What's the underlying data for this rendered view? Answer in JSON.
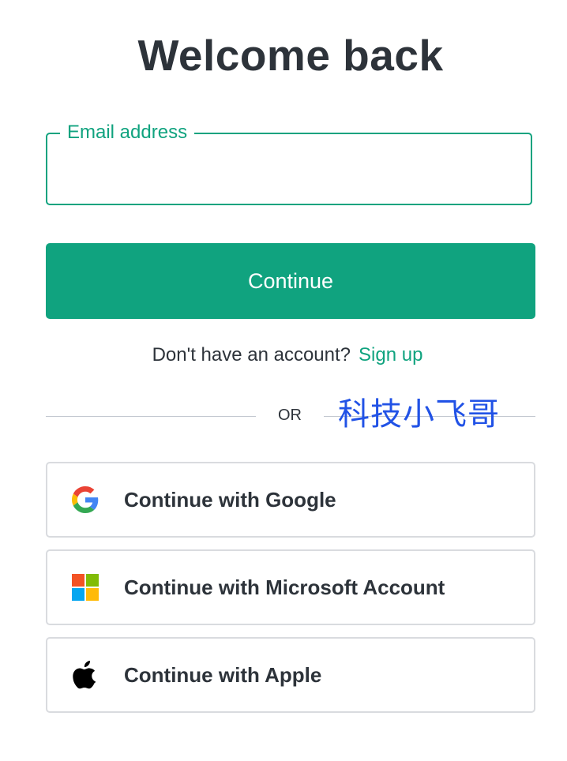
{
  "page": {
    "title": "Welcome back"
  },
  "email": {
    "label": "Email address",
    "value": ""
  },
  "continue_button": {
    "label": "Continue"
  },
  "signup": {
    "prompt": "Don't have an account?",
    "link": "Sign up"
  },
  "divider": {
    "text": "OR"
  },
  "watermark": {
    "text": "科技小飞哥"
  },
  "social_buttons": [
    {
      "label": "Continue with Google",
      "icon": "google-icon"
    },
    {
      "label": "Continue with Microsoft Account",
      "icon": "microsoft-icon"
    },
    {
      "label": "Continue with Apple",
      "icon": "apple-icon"
    }
  ],
  "colors": {
    "accent": "#10a37f",
    "text": "#2d333a",
    "border": "#d9dbdf",
    "watermark": "#2152e6"
  }
}
